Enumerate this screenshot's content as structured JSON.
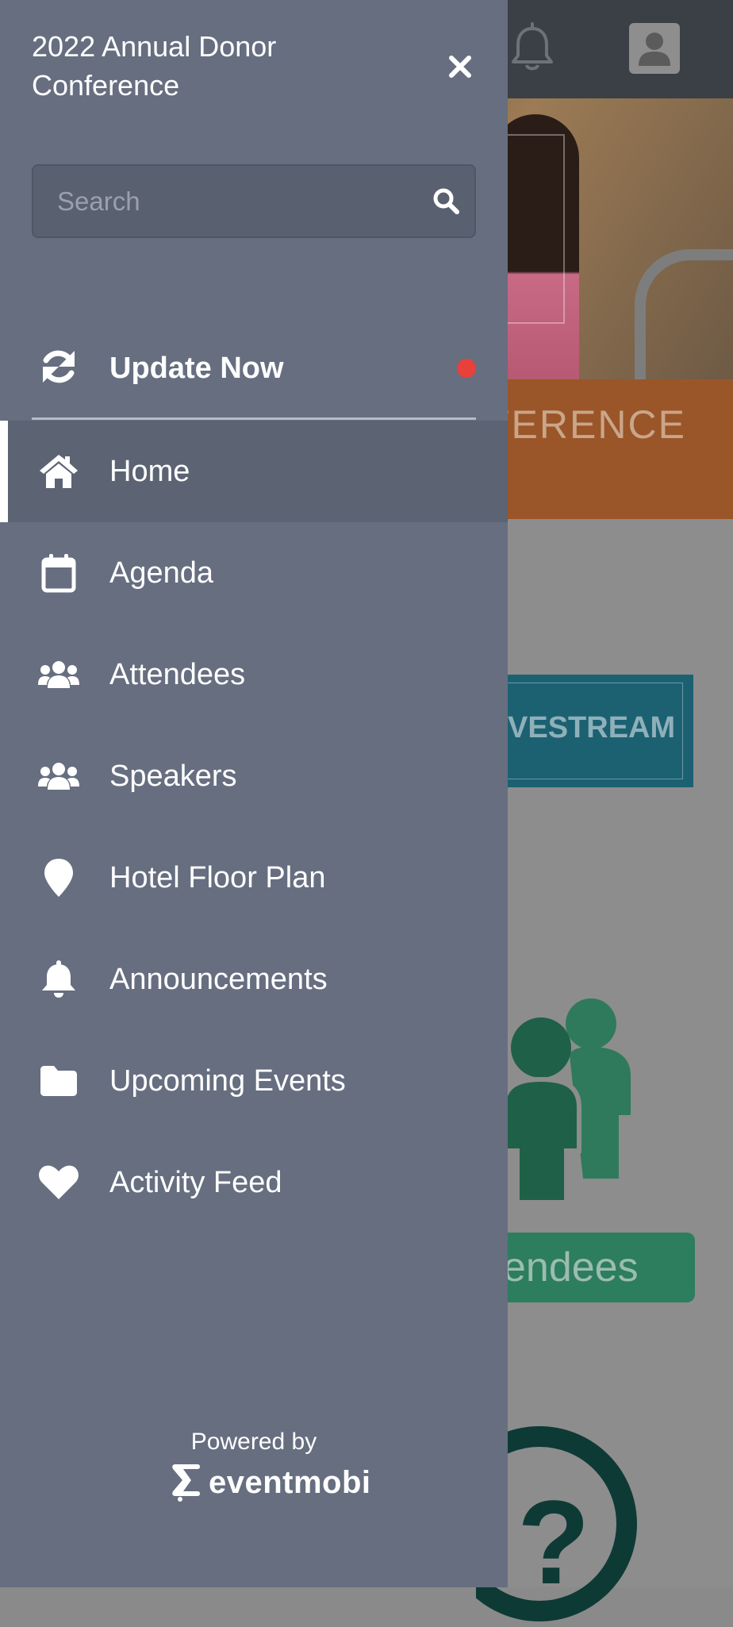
{
  "drawer": {
    "title": "2022 Annual Donor Conference",
    "search": {
      "placeholder": "Search",
      "value": ""
    },
    "update": {
      "label": "Update Now",
      "has_notification": true
    },
    "nav_items": [
      {
        "label": "Home",
        "icon": "home-icon",
        "active": true
      },
      {
        "label": "Agenda",
        "icon": "calendar-icon",
        "active": false
      },
      {
        "label": "Attendees",
        "icon": "users-icon",
        "active": false
      },
      {
        "label": "Speakers",
        "icon": "users-icon",
        "active": false
      },
      {
        "label": "Hotel Floor Plan",
        "icon": "map-pin-icon",
        "active": false
      },
      {
        "label": "Announcements",
        "icon": "bell-icon",
        "active": false
      },
      {
        "label": "Upcoming Events",
        "icon": "folder-icon",
        "active": false
      },
      {
        "label": "Activity Feed",
        "icon": "heart-icon",
        "active": false
      }
    ],
    "footer": {
      "powered_by": "Powered by",
      "brand": "eventmobi"
    }
  },
  "background": {
    "banner_text": "FERENCE",
    "livestream_text": "VESTREAM",
    "attendees_button": "endees"
  },
  "colors": {
    "drawer_bg": "#666e80",
    "active_item_bg": "#5c6373",
    "notification_dot": "#e8403a",
    "topbar_bg": "#3b4047"
  }
}
